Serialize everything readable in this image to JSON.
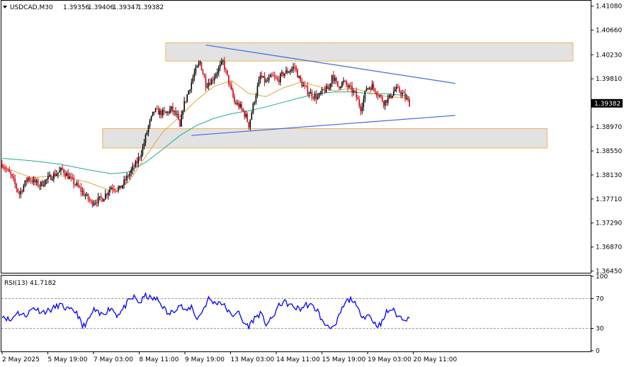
{
  "header": {
    "symbol": "USDCAD,M30",
    "open": "1.39356",
    "high": "1.39406",
    "low": "1.39347",
    "close": "1.39382"
  },
  "current_price_label": "1.39382",
  "colors": {
    "background": "#ffffff",
    "bull_candle": "#000000",
    "bear_candle": "#d3000e",
    "ma_fast": "#e0a63a",
    "ma_slow": "#1fae8c",
    "trendline": "#4169e1",
    "zone_fill": "#e2e2e2",
    "zone_border": "#f0b45a",
    "rsi_line": "#0000ff",
    "grid_level": "#999999"
  },
  "chart_data": [
    {
      "type": "candlestick",
      "symbol": "USDCAD",
      "timeframe": "M30",
      "y_ticks": [
        "1.41080",
        "1.40660",
        "1.40230",
        "1.39810",
        "1.39382",
        "1.38970",
        "1.38550",
        "1.38130",
        "1.37710",
        "1.37290",
        "1.36870",
        "1.36450"
      ],
      "ylim": [
        1.3642,
        1.4115
      ],
      "x_ticks": [
        "2 May 2025",
        "5 May 19:00",
        "7 May 03:00",
        "8 May 11:00",
        "9 May 19:00",
        "13 May 03:00",
        "14 May 11:00",
        "15 May 19:00",
        "19 May 03:00",
        "20 May 11:00"
      ],
      "last_price": 1.39382,
      "moving_averages": [
        {
          "color": "#e0a63a",
          "description": "faster moving average (orange)"
        },
        {
          "color": "#1fae8c",
          "description": "slower moving average (teal)"
        }
      ],
      "price_path": [
        [
          0,
          1.3832
        ],
        [
          3,
          1.3812
        ],
        [
          6,
          1.378
        ],
        [
          9,
          1.3808
        ],
        [
          13,
          1.3795
        ],
        [
          17,
          1.381
        ],
        [
          21,
          1.3822
        ],
        [
          24,
          1.3805
        ],
        [
          28,
          1.3783
        ],
        [
          31,
          1.3765
        ],
        [
          35,
          1.3772
        ],
        [
          38,
          1.3792
        ],
        [
          41,
          1.3788
        ],
        [
          44,
          1.3812
        ],
        [
          47,
          1.3835
        ],
        [
          49,
          1.386
        ],
        [
          51,
          1.3898
        ],
        [
          53,
          1.3925
        ],
        [
          55,
          1.3922
        ],
        [
          57,
          1.392
        ],
        [
          59,
          1.3928
        ],
        [
          61,
          1.3915
        ],
        [
          62,
          1.3895
        ],
        [
          63,
          1.393
        ],
        [
          65,
          1.396
        ],
        [
          67,
          1.399
        ],
        [
          69,
          1.401
        ],
        [
          71,
          1.3972
        ],
        [
          73,
          1.3978
        ],
        [
          75,
          1.3995
        ],
        [
          77,
          1.401
        ],
        [
          79,
          1.3975
        ],
        [
          81,
          1.394
        ],
        [
          83,
          1.3932
        ],
        [
          85,
          1.3915
        ],
        [
          86,
          1.39
        ],
        [
          88,
          1.3945
        ],
        [
          90,
          1.3985
        ],
        [
          92,
          1.3975
        ],
        [
          94,
          1.3985
        ],
        [
          96,
          1.3978
        ],
        [
          98,
          1.399
        ],
        [
          100,
          1.3995
        ],
        [
          102,
          1.4002
        ],
        [
          104,
          1.3975
        ],
        [
          106,
          1.3962
        ],
        [
          108,
          1.3953
        ],
        [
          110,
          1.3948
        ],
        [
          112,
          1.396
        ],
        [
          114,
          1.3965
        ],
        [
          115,
          1.3988
        ],
        [
          117,
          1.3968
        ],
        [
          119,
          1.3975
        ],
        [
          121,
          1.3965
        ],
        [
          123,
          1.3955
        ],
        [
          125,
          1.393
        ],
        [
          126,
          1.3945
        ],
        [
          127,
          1.3965
        ],
        [
          129,
          1.3968
        ],
        [
          131,
          1.3955
        ],
        [
          133,
          1.394
        ],
        [
          135,
          1.3948
        ],
        [
          137,
          1.3963
        ],
        [
          139,
          1.3958
        ],
        [
          141,
          1.3945
        ],
        [
          142,
          1.3938
        ]
      ],
      "fast_ma": [
        [
          0,
          1.3828
        ],
        [
          10,
          1.3808
        ],
        [
          20,
          1.3812
        ],
        [
          30,
          1.38
        ],
        [
          38,
          1.3785
        ],
        [
          44,
          1.38
        ],
        [
          50,
          1.3845
        ],
        [
          56,
          1.3888
        ],
        [
          62,
          1.3915
        ],
        [
          68,
          1.3945
        ],
        [
          74,
          1.3968
        ],
        [
          80,
          1.3978
        ],
        [
          86,
          1.3955
        ],
        [
          92,
          1.395
        ],
        [
          98,
          1.3965
        ],
        [
          104,
          1.3975
        ],
        [
          110,
          1.3968
        ],
        [
          116,
          1.396
        ],
        [
          122,
          1.3965
        ],
        [
          128,
          1.3957
        ],
        [
          134,
          1.395
        ],
        [
          140,
          1.3948
        ],
        [
          142,
          1.3945
        ]
      ],
      "slow_ma": [
        [
          0,
          1.3842
        ],
        [
          10,
          1.3838
        ],
        [
          20,
          1.3832
        ],
        [
          30,
          1.3822
        ],
        [
          38,
          1.3815
        ],
        [
          44,
          1.3818
        ],
        [
          50,
          1.3835
        ],
        [
          56,
          1.3858
        ],
        [
          62,
          1.3882
        ],
        [
          68,
          1.39
        ],
        [
          74,
          1.3912
        ],
        [
          80,
          1.392
        ],
        [
          86,
          1.3925
        ],
        [
          92,
          1.3932
        ],
        [
          98,
          1.394
        ],
        [
          104,
          1.3948
        ],
        [
          110,
          1.3955
        ],
        [
          116,
          1.3958
        ],
        [
          122,
          1.3958
        ],
        [
          128,
          1.3955
        ],
        [
          134,
          1.3955
        ],
        [
          140,
          1.3952
        ],
        [
          142,
          1.395
        ]
      ],
      "zones": [
        {
          "name": "resistance zone",
          "from_bar": 57,
          "to_bar": 199,
          "top": 1.4044,
          "bottom": 1.4012
        },
        {
          "name": "support zone",
          "from_bar": 35,
          "to_bar": 190,
          "top": 1.3894,
          "bottom": 1.386
        }
      ],
      "trendlines": [
        {
          "name": "upper trendline",
          "from": [
            71,
            1.404
          ],
          "to": [
            158,
            1.3973
          ]
        },
        {
          "name": "lower trendline",
          "from": [
            66,
            1.3882
          ],
          "to": [
            158,
            1.3917
          ]
        }
      ]
    },
    {
      "type": "line",
      "name": "RSI(13)",
      "label": "RSI(13) 41.7182",
      "y_ticks": [
        "100",
        "70",
        "30",
        "0"
      ],
      "levels": [
        70,
        30
      ],
      "ylim": [
        0,
        100
      ],
      "last_value": 41.7182,
      "values": [
        [
          0,
          48
        ],
        [
          3,
          40
        ],
        [
          5,
          52
        ],
        [
          8,
          47
        ],
        [
          11,
          58
        ],
        [
          14,
          52
        ],
        [
          17,
          55
        ],
        [
          20,
          62
        ],
        [
          23,
          55
        ],
        [
          26,
          52
        ],
        [
          28,
          32
        ],
        [
          30,
          40
        ],
        [
          32,
          55
        ],
        [
          34,
          48
        ],
        [
          36,
          52
        ],
        [
          38,
          58
        ],
        [
          40,
          48
        ],
        [
          42,
          55
        ],
        [
          44,
          66
        ],
        [
          46,
          72
        ],
        [
          48,
          64
        ],
        [
          50,
          74
        ],
        [
          52,
          70
        ],
        [
          54,
          69
        ],
        [
          56,
          60
        ],
        [
          58,
          48
        ],
        [
          60,
          55
        ],
        [
          62,
          62
        ],
        [
          64,
          52
        ],
        [
          66,
          60
        ],
        [
          68,
          42
        ],
        [
          70,
          55
        ],
        [
          72,
          70
        ],
        [
          74,
          64
        ],
        [
          76,
          66
        ],
        [
          78,
          58
        ],
        [
          80,
          46
        ],
        [
          82,
          54
        ],
        [
          84,
          38
        ],
        [
          86,
          33
        ],
        [
          88,
          44
        ],
        [
          90,
          50
        ],
        [
          92,
          36
        ],
        [
          94,
          42
        ],
        [
          96,
          58
        ],
        [
          98,
          66
        ],
        [
          100,
          62
        ],
        [
          102,
          58
        ],
        [
          104,
          56
        ],
        [
          106,
          62
        ],
        [
          108,
          60
        ],
        [
          110,
          54
        ],
        [
          112,
          36
        ],
        [
          114,
          34
        ],
        [
          116,
          30
        ],
        [
          118,
          52
        ],
        [
          120,
          66
        ],
        [
          122,
          70
        ],
        [
          124,
          55
        ],
        [
          126,
          46
        ],
        [
          128,
          48
        ],
        [
          130,
          36
        ],
        [
          132,
          34
        ],
        [
          134,
          52
        ],
        [
          136,
          56
        ],
        [
          138,
          46
        ],
        [
          140,
          44
        ],
        [
          142,
          42
        ]
      ]
    }
  ]
}
